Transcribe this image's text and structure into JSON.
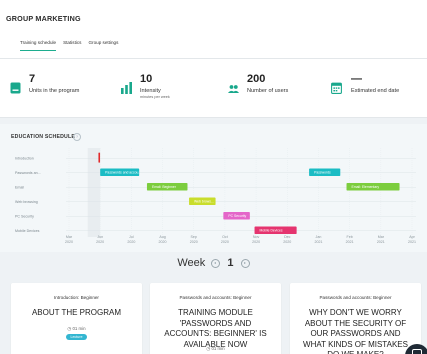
{
  "header": {
    "title": "GROUP MARKETING",
    "tabs": [
      {
        "label": "Training schedule",
        "active": true
      },
      {
        "label": "Statistics",
        "active": false
      },
      {
        "label": "Group settings",
        "active": false
      }
    ]
  },
  "stats": [
    {
      "value": "7",
      "label": "Units in the program",
      "sub": "",
      "icon": "document-icon"
    },
    {
      "value": "10",
      "label": "Intensity",
      "sub": "minutes per week",
      "icon": "bar-chart-icon"
    },
    {
      "value": "200",
      "label": "Number of users",
      "sub": "",
      "icon": "users-icon"
    },
    {
      "value": "—",
      "label": "Estimated end date",
      "sub": "",
      "icon": "calendar-icon"
    }
  ],
  "schedule": {
    "title": "EDUCATION SCHEDULE",
    "help_icon": "help-circle-icon",
    "rows": [
      "Introduction",
      "Passwords an...",
      "Email",
      "Web browsing",
      "PC Security",
      "Mobile Devices"
    ],
    "months": [
      {
        "m": "Mar",
        "y": "2020"
      },
      {
        "m": "Jun",
        "y": "2020"
      },
      {
        "m": "Jul",
        "y": "2020"
      },
      {
        "m": "Aug",
        "y": "2020"
      },
      {
        "m": "Sep",
        "y": "2020"
      },
      {
        "m": "Oct",
        "y": "2020"
      },
      {
        "m": "Nov",
        "y": "2020"
      },
      {
        "m": "Dec",
        "y": "2020"
      },
      {
        "m": "Jan",
        "y": "2021"
      },
      {
        "m": "Feb",
        "y": "2021"
      },
      {
        "m": "Mar",
        "y": "2021"
      },
      {
        "m": "Apr",
        "y": "2021"
      }
    ],
    "bars": [
      {
        "row": 1,
        "start": 1.0,
        "end": 2.25,
        "label": "Passwords and accou...",
        "color": "#1bbcc4"
      },
      {
        "row": 1,
        "start": 7.7,
        "end": 8.7,
        "label": "Passwords",
        "color": "#1bbcc4"
      },
      {
        "row": 2,
        "start": 2.5,
        "end": 3.8,
        "label": "Email: Beginner",
        "color": "#7ccd3e"
      },
      {
        "row": 2,
        "start": 8.9,
        "end": 10.6,
        "label": "Email: Elementary",
        "color": "#7ccd3e"
      },
      {
        "row": 3,
        "start": 3.85,
        "end": 4.7,
        "label": "Web brows...",
        "color": "#c9dd2c"
      },
      {
        "row": 4,
        "start": 4.95,
        "end": 5.8,
        "label": "PC Security",
        "color": "#e466c9"
      },
      {
        "row": 5,
        "start": 5.95,
        "end": 7.3,
        "label": "Mobile Devices",
        "color": "#e5346f"
      }
    ],
    "current_marker": {
      "row": 0,
      "pos": 0.97,
      "color": "#e22a2a"
    }
  },
  "week": {
    "label": "Week",
    "number": "1"
  },
  "cards": [
    {
      "topic": "Introduction: Beginner",
      "title": "ABOUT THE PROGRAM",
      "duration": "01 min",
      "badge": "Lecture"
    },
    {
      "topic": "Passwords and accounts: Beginner",
      "title": "TRAINING MODULE 'PASSWORDS AND ACCOUNTS: BEGINNER' IS AVAILABLE NOW",
      "duration": "01 min",
      "badge": ""
    },
    {
      "topic": "Passwords and accounts: Beginner",
      "title": "WHY DON'T WE WORRY ABOUT THE SECURITY OF OUR PASSWORDS AND WHAT KINDS OF MISTAKES DO WE MAKE?",
      "duration": "",
      "badge": ""
    }
  ],
  "colors": {
    "accent": "#1dad8f",
    "icon": "#19a88c"
  }
}
